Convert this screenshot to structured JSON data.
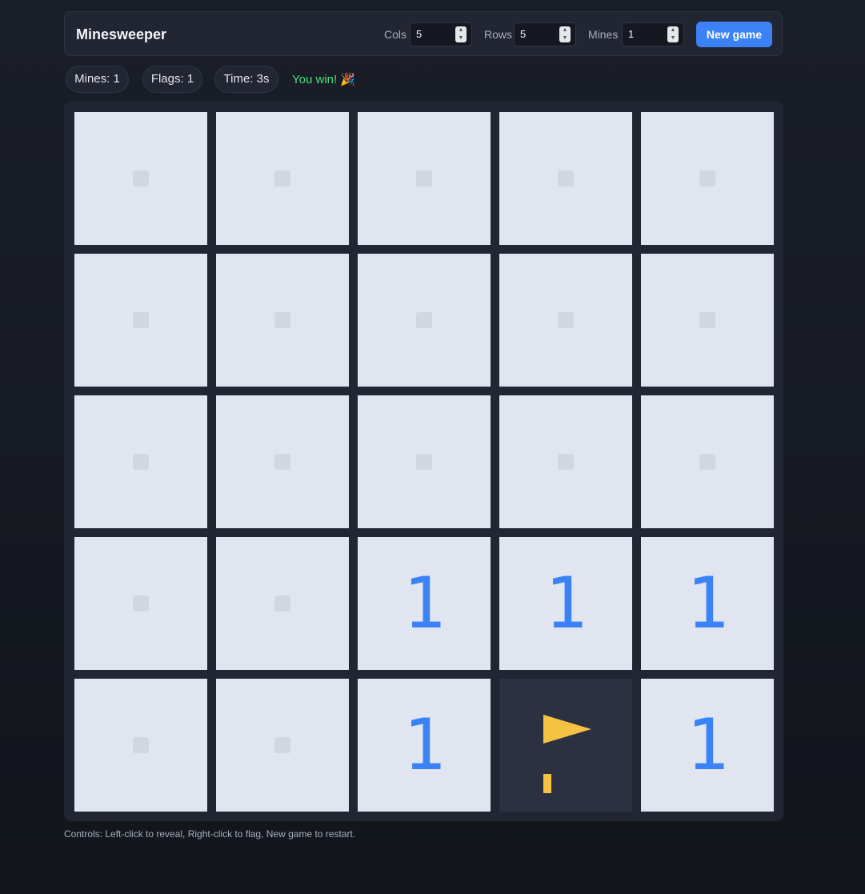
{
  "header": {
    "title": "Minesweeper",
    "cols_label": "Cols",
    "cols_value": "5",
    "rows_label": "Rows",
    "rows_value": "5",
    "mines_label": "Mines",
    "mines_value": "1",
    "new_game_label": "New game"
  },
  "stats": {
    "mines": "Mines: 1",
    "flags": "Flags: 1",
    "time": "Time: 3s",
    "status_text": "You win!",
    "status_emoji": "🎉"
  },
  "board": {
    "rows": 5,
    "cols": 5,
    "cells": [
      [
        "",
        "",
        "",
        "",
        ""
      ],
      [
        "",
        "",
        "",
        "",
        ""
      ],
      [
        "",
        "",
        "",
        "",
        ""
      ],
      [
        "",
        "",
        "1",
        "1",
        "1"
      ],
      [
        "",
        "",
        "1",
        "F",
        "1"
      ]
    ]
  },
  "colors": {
    "accent": "#3b82f6",
    "win_text": "#4ade80",
    "number_one": "#3b82f6",
    "flag": "#f5c242"
  },
  "footer": {
    "controls_text": "Controls: Left-click to reveal, Right-click to flag, New game to restart."
  }
}
